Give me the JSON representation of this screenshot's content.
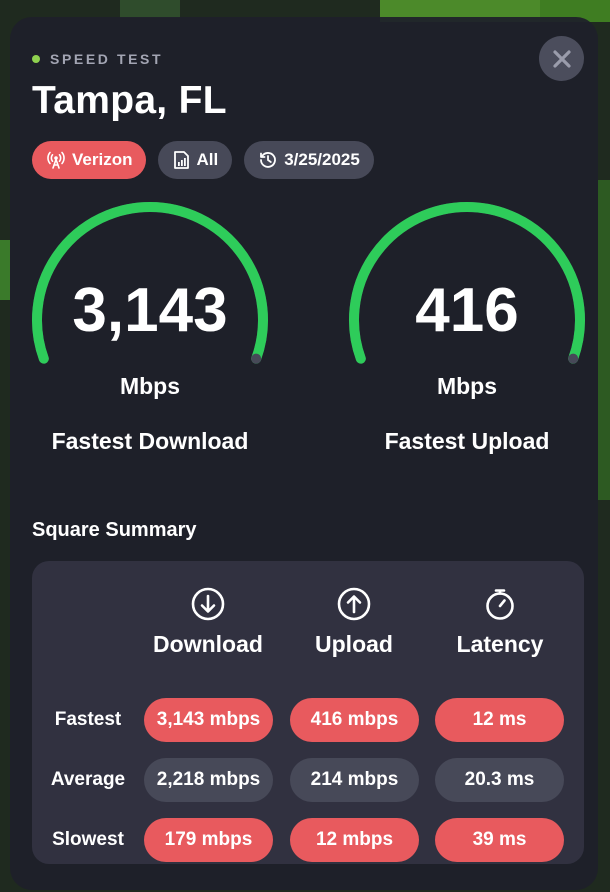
{
  "header": {
    "eyebrow": "SPEED TEST",
    "title": "Tampa, FL",
    "close_icon": "close-icon"
  },
  "chips": [
    {
      "label": "Verizon",
      "icon": "cell-tower-icon"
    },
    {
      "label": "All",
      "icon": "sim-card-icon"
    },
    {
      "label": "3/25/2025",
      "icon": "history-icon"
    }
  ],
  "gauges": [
    {
      "value": "3,143",
      "unit": "Mbps",
      "label": "Fastest Download",
      "fill": 1.0
    },
    {
      "value": "416",
      "unit": "Mbps",
      "label": "Fastest Upload",
      "fill": 1.0
    }
  ],
  "summary": {
    "title": "Square Summary",
    "columns": [
      {
        "label": "Download",
        "icon": "download-circle-icon"
      },
      {
        "label": "Upload",
        "icon": "upload-circle-icon"
      },
      {
        "label": "Latency",
        "icon": "stopwatch-icon"
      }
    ],
    "rows": [
      {
        "label": "Fastest",
        "cells": [
          {
            "text": "3,143 mbps",
            "tone": "red"
          },
          {
            "text": "416 mbps",
            "tone": "red"
          },
          {
            "text": "12 ms",
            "tone": "red"
          }
        ]
      },
      {
        "label": "Average",
        "cells": [
          {
            "text": "2,218 mbps",
            "tone": "gray"
          },
          {
            "text": "214 mbps",
            "tone": "gray"
          },
          {
            "text": "20.3 ms",
            "tone": "gray"
          }
        ]
      },
      {
        "label": "Slowest",
        "cells": [
          {
            "text": "179 mbps",
            "tone": "red"
          },
          {
            "text": "12 mbps",
            "tone": "red"
          },
          {
            "text": "39 ms",
            "tone": "red"
          }
        ]
      }
    ]
  },
  "colors": {
    "accent_green": "#2ecc5a",
    "chip_red": "#e85a5e",
    "pill_red": "#e85a5e",
    "pill_gray": "#474958",
    "eyebrow_dot": "#8fd14f",
    "track": "#474958"
  }
}
